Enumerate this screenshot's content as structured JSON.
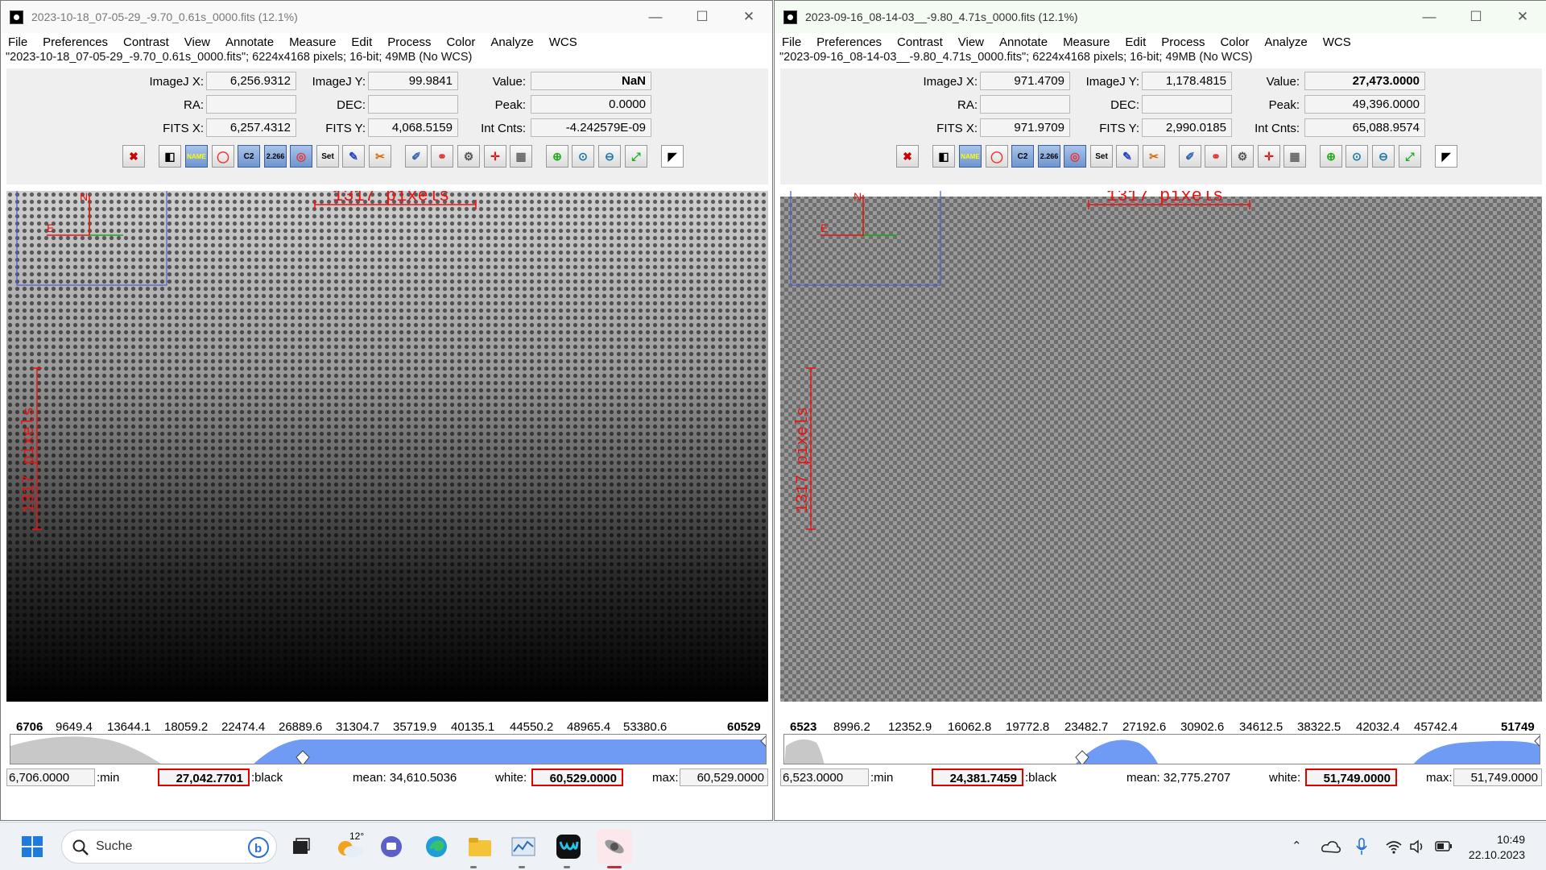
{
  "menus": [
    "File",
    "Preferences",
    "Contrast",
    "View",
    "Annotate",
    "Measure",
    "Edit",
    "Process",
    "Color",
    "Analyze",
    "WCS"
  ],
  "window_controls": {
    "minimize": "—",
    "maximize": "☐",
    "close": "✕"
  },
  "field_labels": {
    "ij_x": "ImageJ X:",
    "ij_y": "ImageJ Y:",
    "value": "Value:",
    "ra": "RA:",
    "dec": "DEC:",
    "peak": "Peak:",
    "fits_x": "FITS X:",
    "fits_y": "FITS Y:",
    "int_cnts": "Int Cnts:"
  },
  "bottom_labels": {
    "min": ":min",
    "black": ":black",
    "white": "white:",
    "max": "max:"
  },
  "tool_labels": {
    "set": "Set",
    "c2": "C2",
    "zoom": "2.266",
    "name": "NAME"
  },
  "overlay": {
    "pixels_label": "1317 pixels",
    "north": "N",
    "east": "E"
  },
  "windows": [
    {
      "title": "2023-10-18_07-05-29_-9.70_0.61s_0000.fits (12.1%)",
      "status": "\"2023-10-18_07-05-29_-9.70_0.61s_0000.fits\"; 6224x4168 pixels; 16-bit; 49MB (No WCS)",
      "fields": {
        "ij_x": "6,256.9312",
        "ij_y": "99.9841",
        "value": "NaN",
        "ra": "",
        "dec": "",
        "peak": "0.0000",
        "fits_x": "6,257.4312",
        "fits_y": "4,068.5159",
        "int_cnts": "-4.242579E-09"
      },
      "ticks": [
        "6706",
        "9649.4",
        "13644.1",
        "18059.2",
        "22474.4",
        "26889.6",
        "31304.7",
        "35719.9",
        "40135.1",
        "44550.2",
        "48965.4",
        "53380.6",
        "60529"
      ],
      "bottom": {
        "min": "6,706.0000",
        "black": "27,042.7701",
        "mean": "mean: 34,610.5036",
        "white": "60,529.0000",
        "max": "60,529.0000"
      },
      "colors": {
        "histogram_fill": "#6f9bf5",
        "image_top": "#cfcfcf",
        "image_bottom": "#000000"
      }
    },
    {
      "title": "2023-09-16_08-14-03__-9.80_4.71s_0000.fits (12.1%)",
      "status": "\"2023-09-16_08-14-03__-9.80_4.71s_0000.fits\"; 6224x4168 pixels; 16-bit; 49MB (No WCS)",
      "fields": {
        "ij_x": "971.4709",
        "ij_y": "1,178.4815",
        "value": "27,473.0000",
        "ra": "",
        "dec": "",
        "peak": "49,396.0000",
        "fits_x": "971.9709",
        "fits_y": "2,990.0185",
        "int_cnts": "65,088.9574"
      },
      "ticks": [
        "6523",
        "8996.2",
        "12352.9",
        "16062.8",
        "19772.8",
        "23482.7",
        "27192.6",
        "30902.6",
        "34612.5",
        "38322.5",
        "42032.4",
        "45742.4",
        "51749"
      ],
      "bottom": {
        "min": "6,523.0000",
        "black": "24,381.7459",
        "mean": "mean: 32,775.2707",
        "white": "51,749.0000",
        "max": "51,749.0000"
      },
      "colors": {
        "histogram_fill": "#6f9bf5",
        "image_top": "#8a8a8a",
        "image_bottom": "#5a5a5a"
      }
    }
  ],
  "taskbar": {
    "search_placeholder": "Suche",
    "weather_temp": "12°",
    "time": "10:49",
    "date": "22.10.2023",
    "icons": [
      "start-icon",
      "search-icon",
      "bing-icon",
      "task-view-icon",
      "weather-icon",
      "teams-chat-icon",
      "edge-icon",
      "file-explorer-icon",
      "astroimagej-icon",
      "webex-icon",
      "telescope-app-icon"
    ]
  }
}
